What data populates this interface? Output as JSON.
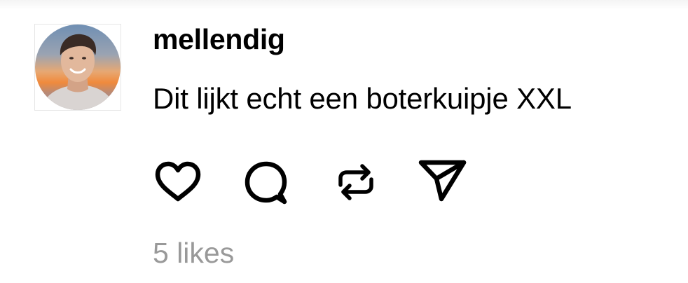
{
  "post": {
    "username": "mellendig",
    "text": "Dit lijkt echt een boterkuipje XXL",
    "likes_label": "5 likes"
  },
  "icons": {
    "like": "heart-icon",
    "comment": "comment-bubble-icon",
    "repost": "repost-icon",
    "share": "send-icon"
  },
  "colors": {
    "text": "#000000",
    "secondary_text": "#999999",
    "background": "#ffffff"
  }
}
